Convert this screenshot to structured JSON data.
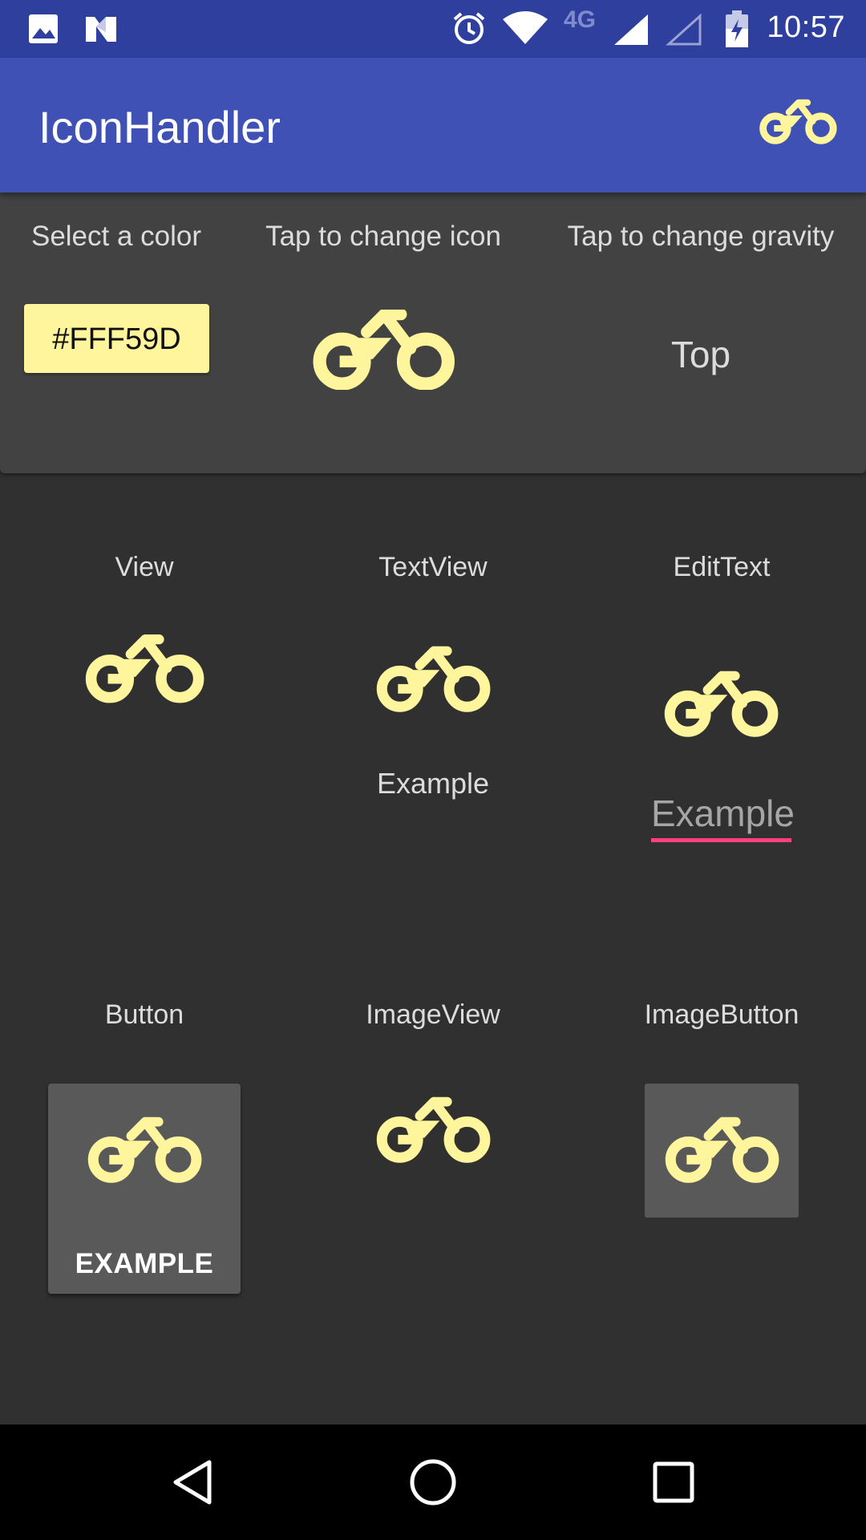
{
  "status_bar": {
    "time": "10:57",
    "network_type": "4G",
    "icons": [
      "image-icon",
      "n-logo-icon",
      "alarm-icon",
      "wifi-icon",
      "signal-icon",
      "signal-empty-icon",
      "battery-charging-icon"
    ]
  },
  "app_bar": {
    "title": "IconHandler",
    "action_icon": "motorcycle-icon"
  },
  "controls": {
    "color_label": "Select a color",
    "color_value": "#FFF59D",
    "icon_label": "Tap to change icon",
    "gravity_label": "Tap to change gravity",
    "gravity_value": "Top"
  },
  "demos": {
    "view": {
      "label": "View"
    },
    "textview": {
      "label": "TextView",
      "text": "Example"
    },
    "edittext": {
      "label": "EditText",
      "text": "Example"
    },
    "button": {
      "label": "Button",
      "text": "EXAMPLE"
    },
    "imageview": {
      "label": "ImageView"
    },
    "imagebutton": {
      "label": "ImageButton"
    }
  },
  "colors": {
    "icon": "#FFF59D",
    "primary": "#3F51B5",
    "primary_dark": "#2F3F9E",
    "accent": "#FF4081",
    "background": "#303030",
    "card": "#424242"
  },
  "nav_bar": {
    "icons": [
      "back-icon",
      "home-icon",
      "recents-icon"
    ]
  }
}
